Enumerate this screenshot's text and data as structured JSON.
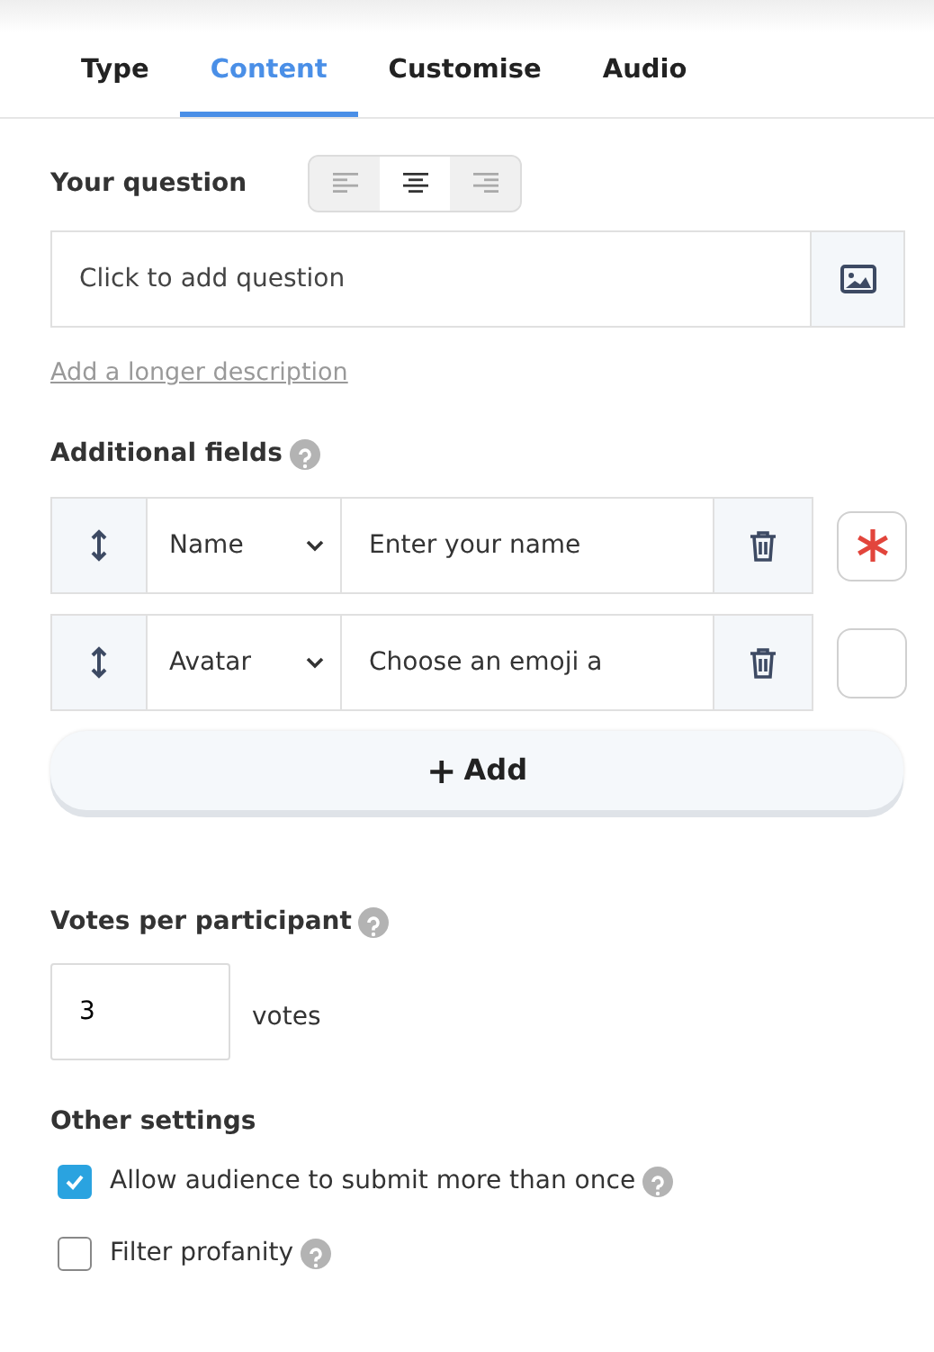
{
  "tabs": [
    {
      "label": "Type",
      "selected": false
    },
    {
      "label": "Content",
      "selected": true
    },
    {
      "label": "Customise",
      "selected": false
    },
    {
      "label": "Audio",
      "selected": false
    }
  ],
  "question": {
    "label": "Your question",
    "alignment": [
      {
        "kind": "left",
        "selected": false
      },
      {
        "kind": "center",
        "selected": true
      },
      {
        "kind": "right",
        "selected": false
      }
    ],
    "placeholder": "Click to add question",
    "description_link": "Add a longer description"
  },
  "additional_fields": {
    "label": "Additional fields",
    "fields": [
      {
        "type": "Name",
        "value": "Enter your name",
        "required": true
      },
      {
        "type": "Avatar",
        "value": "Choose an emoji a",
        "required": false
      }
    ],
    "add_button": "Add",
    "add_icon": "+"
  },
  "votes": {
    "label": "Votes per participant",
    "value": "3",
    "unit": "votes"
  },
  "other_settings": {
    "label": "Other settings",
    "options": [
      {
        "label": "Allow audience to submit more than once",
        "checked": true
      },
      {
        "label": "Filter profanity",
        "checked": false
      }
    ]
  }
}
